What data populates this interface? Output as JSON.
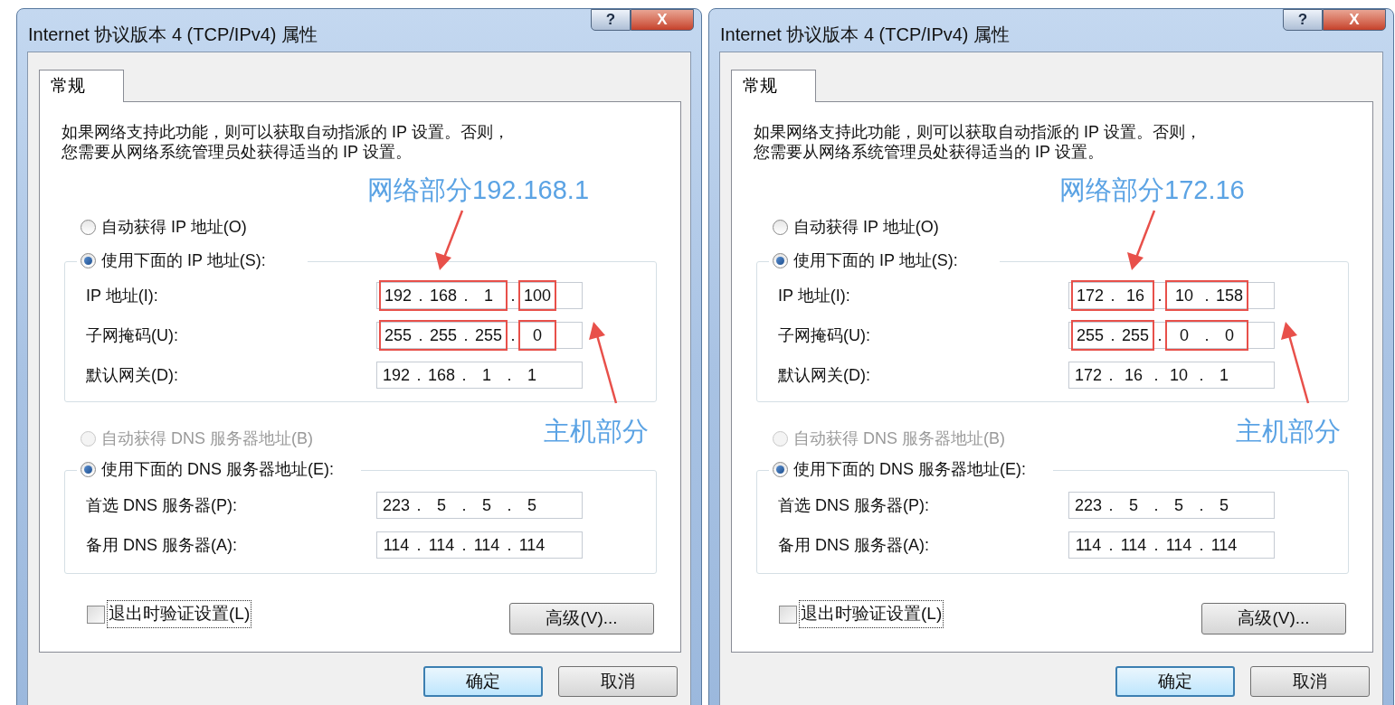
{
  "dialogs": [
    {
      "title": "Internet 协议版本 4 (TCP/IPv4) 属性",
      "title_buttons": [
        {
          "kind": "help",
          "glyph": "?"
        },
        {
          "kind": "close",
          "glyph": "X"
        }
      ],
      "tabs": [
        {
          "label": "常规",
          "selected": true
        }
      ],
      "description_lines": [
        "如果网络支持此功能，则可以获取自动指派的 IP 设置。否则，",
        "您需要从网络系统管理员处获得适当的 IP 设置。"
      ],
      "network_note": "网络部分192.168.1",
      "host_note": "主机部分",
      "octet_separator": ".",
      "ip_auto": {
        "label": "自动获得 IP 地址(O)",
        "selected": false,
        "disabled": false
      },
      "ip_manual": {
        "label": "使用下面的 IP 地址(S):",
        "selected": true,
        "disabled": false
      },
      "ip_fields": [
        {
          "label": "IP 地址(I):",
          "parts": [
            {
              "highlighted": true,
              "octets": [
                "192",
                "168",
                "1"
              ]
            },
            {
              "highlighted": true,
              "octets": [
                "100"
              ]
            }
          ]
        },
        {
          "label": "子网掩码(U):",
          "parts": [
            {
              "highlighted": true,
              "octets": [
                "255",
                "255",
                "255"
              ]
            },
            {
              "highlighted": true,
              "octets": [
                "0"
              ]
            }
          ]
        },
        {
          "label": "默认网关(D):",
          "octets": [
            "192",
            "168",
            "1",
            "1"
          ]
        }
      ],
      "dns_auto": {
        "label": "自动获得 DNS 服务器地址(B)",
        "selected": false,
        "disabled": true
      },
      "dns_manual": {
        "label": "使用下面的 DNS 服务器地址(E):",
        "selected": true,
        "disabled": false
      },
      "dns_fields": [
        {
          "label": "首选 DNS 服务器(P):",
          "octets": [
            "223",
            "5",
            "5",
            "5"
          ]
        },
        {
          "label": "备用 DNS 服务器(A):",
          "octets": [
            "114",
            "114",
            "114",
            "114"
          ]
        }
      ],
      "validate": {
        "label": "退出时验证设置(L)",
        "checked": false
      },
      "advanced_button": "高级(V)...",
      "buttons": [
        {
          "label": "确定",
          "default": true
        },
        {
          "label": "取消",
          "default": false
        }
      ]
    },
    {
      "title": "Internet 协议版本 4 (TCP/IPv4) 属性",
      "title_buttons": [
        {
          "kind": "help",
          "glyph": "?"
        },
        {
          "kind": "close",
          "glyph": "X"
        }
      ],
      "tabs": [
        {
          "label": "常规",
          "selected": true
        }
      ],
      "description_lines": [
        "如果网络支持此功能，则可以获取自动指派的 IP 设置。否则，",
        "您需要从网络系统管理员处获得适当的 IP 设置。"
      ],
      "network_note": "网络部分172.16",
      "host_note": "主机部分",
      "octet_separator": ".",
      "ip_auto": {
        "label": "自动获得 IP 地址(O)",
        "selected": false,
        "disabled": false
      },
      "ip_manual": {
        "label": "使用下面的 IP 地址(S):",
        "selected": true,
        "disabled": false
      },
      "ip_fields": [
        {
          "label": "IP 地址(I):",
          "parts": [
            {
              "highlighted": true,
              "octets": [
                "172",
                "16"
              ]
            },
            {
              "highlighted": true,
              "octets": [
                "10",
                "158"
              ]
            }
          ]
        },
        {
          "label": "子网掩码(U):",
          "parts": [
            {
              "highlighted": true,
              "octets": [
                "255",
                "255"
              ]
            },
            {
              "highlighted": true,
              "octets": [
                "0",
                "0"
              ]
            }
          ]
        },
        {
          "label": "默认网关(D):",
          "octets": [
            "172",
            "16",
            "10",
            "1"
          ]
        }
      ],
      "dns_auto": {
        "label": "自动获得 DNS 服务器地址(B)",
        "selected": false,
        "disabled": true
      },
      "dns_manual": {
        "label": "使用下面的 DNS 服务器地址(E):",
        "selected": true,
        "disabled": false
      },
      "dns_fields": [
        {
          "label": "首选 DNS 服务器(P):",
          "octets": [
            "223",
            "5",
            "5",
            "5"
          ]
        },
        {
          "label": "备用 DNS 服务器(A):",
          "octets": [
            "114",
            "114",
            "114",
            "114"
          ]
        }
      ],
      "validate": {
        "label": "退出时验证设置(L)",
        "checked": false
      },
      "advanced_button": "高级(V)...",
      "buttons": [
        {
          "label": "确定",
          "default": true
        },
        {
          "label": "取消",
          "default": false
        }
      ]
    }
  ]
}
